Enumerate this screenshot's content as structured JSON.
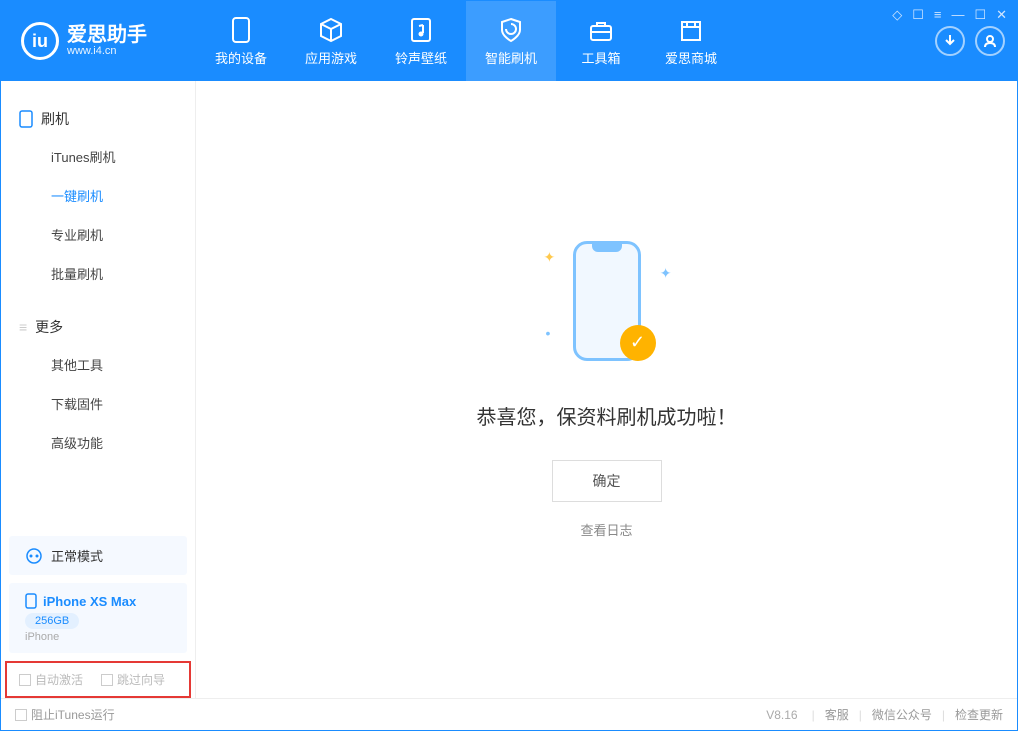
{
  "app": {
    "name": "爱思助手",
    "url": "www.i4.cn"
  },
  "nav": [
    {
      "label": "我的设备"
    },
    {
      "label": "应用游戏"
    },
    {
      "label": "铃声壁纸"
    },
    {
      "label": "智能刷机"
    },
    {
      "label": "工具箱"
    },
    {
      "label": "爱思商城"
    }
  ],
  "sidebar": {
    "section1": {
      "title": "刷机",
      "items": [
        "iTunes刷机",
        "一键刷机",
        "专业刷机",
        "批量刷机"
      ]
    },
    "section2": {
      "title": "更多",
      "items": [
        "其他工具",
        "下载固件",
        "高级功能"
      ]
    },
    "status": "正常模式",
    "device": {
      "name": "iPhone XS Max",
      "storage": "256GB",
      "type": "iPhone"
    },
    "checkboxes": {
      "auto_activate": "自动激活",
      "skip_guide": "跳过向导"
    }
  },
  "content": {
    "success_msg": "恭喜您，保资料刷机成功啦！",
    "confirm": "确定",
    "view_log": "查看日志"
  },
  "footer": {
    "block_itunes": "阻止iTunes运行",
    "version": "V8.16",
    "links": [
      "客服",
      "微信公众号",
      "检查更新"
    ]
  }
}
